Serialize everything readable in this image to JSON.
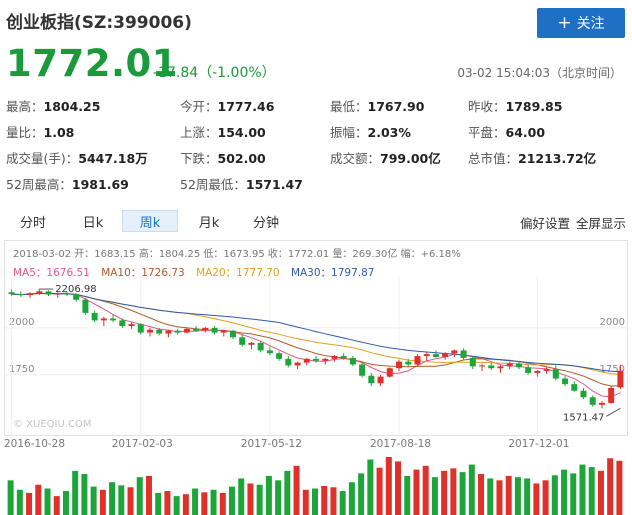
{
  "header": {
    "title": "创业板指(SZ:399006)",
    "follow_label": "关注",
    "price": "1772.01",
    "change": "-17.84（-1.00%）",
    "timestamp": "03-02 15:04:03（北京时间）"
  },
  "stats": [
    {
      "label": "最高：",
      "value": "1804.25"
    },
    {
      "label": "今开：",
      "value": "1777.46"
    },
    {
      "label": "最低：",
      "value": "1767.90"
    },
    {
      "label": "昨收：",
      "value": "1789.85"
    },
    {
      "label": "量比：",
      "value": "1.08"
    },
    {
      "label": "上涨：",
      "value": "154.00"
    },
    {
      "label": "振幅：",
      "value": "2.03%"
    },
    {
      "label": "平盘：",
      "value": "64.00"
    },
    {
      "label": "成交量(手)：",
      "value": "5447.18万"
    },
    {
      "label": "下跌：",
      "value": "502.00"
    },
    {
      "label": "成交额：",
      "value": "799.00亿"
    },
    {
      "label": "总市值：",
      "value": "21213.72亿"
    },
    {
      "label": "52周最高：",
      "value": "1981.69"
    },
    {
      "label": "52周最低：",
      "value": "1571.47"
    }
  ],
  "tabs": [
    {
      "label": "分时"
    },
    {
      "label": "日k"
    },
    {
      "label": "周k"
    },
    {
      "label": "月k"
    },
    {
      "label": "分钟"
    }
  ],
  "tab_active": "周k",
  "tools": {
    "settings": "偏好设置",
    "fullscreen": "全屏显示"
  },
  "chart_info": "2018-03-02 开：1683.15 高：1804.25 低：1673.95 收：1772.01 量：269.30亿 幅：+6.18%",
  "ma_legend": [
    {
      "label": "MA5：1676.51",
      "color": "#e05a8a"
    },
    {
      "label": "MA10：1726.73",
      "color": "#b05a2a"
    },
    {
      "label": "MA20：1777.70",
      "color": "#e0a020"
    },
    {
      "label": "MA30：1797.87",
      "color": "#2f5aa8"
    }
  ],
  "watermark": "© XUEQIU.COM",
  "colors": {
    "up": "#e0302a",
    "down": "#1ea53a",
    "accent": "#1f6fc5"
  },
  "chart_data": {
    "type": "candlestick",
    "y_ticks": [
      {
        "value": 2000,
        "label": "2000"
      },
      {
        "value": 1750,
        "label": "1750"
      }
    ],
    "ylim": [
      1525,
      2250
    ],
    "x_ticks": [
      "2016-10-28",
      "2017-02-03",
      "2017-05-12",
      "2017-08-18",
      "2017-12-01"
    ],
    "x_tick_indices": [
      0,
      14,
      28,
      42,
      57
    ],
    "annotations": [
      {
        "text": "2206.98",
        "index": 3,
        "value": 2206.98
      },
      {
        "text": "1571.47",
        "index": 66,
        "value": 1571.47
      }
    ],
    "candles": [
      [
        2190,
        2205,
        2170,
        2180
      ],
      [
        2180,
        2195,
        2165,
        2175
      ],
      [
        2175,
        2190,
        2160,
        2185
      ],
      [
        2185,
        2207,
        2175,
        2195
      ],
      [
        2195,
        2200,
        2170,
        2178
      ],
      [
        2178,
        2190,
        2160,
        2183
      ],
      [
        2183,
        2195,
        2170,
        2180
      ],
      [
        2180,
        2185,
        2140,
        2150
      ],
      [
        2150,
        2160,
        2070,
        2080
      ],
      [
        2080,
        2090,
        2030,
        2040
      ],
      [
        2040,
        2060,
        2010,
        2050
      ],
      [
        2050,
        2070,
        2030,
        2040
      ],
      [
        2040,
        2050,
        2000,
        2010
      ],
      [
        2010,
        2030,
        1995,
        2020
      ],
      [
        2020,
        2025,
        1965,
        1975
      ],
      [
        1975,
        2000,
        1955,
        1990
      ],
      [
        1990,
        2000,
        1960,
        1970
      ],
      [
        1970,
        1990,
        1950,
        1985
      ],
      [
        1985,
        1995,
        1965,
        1975
      ],
      [
        1975,
        2000,
        1970,
        1995
      ],
      [
        1995,
        2010,
        1980,
        1985
      ],
      [
        1985,
        2005,
        1975,
        2000
      ],
      [
        2000,
        2010,
        1965,
        1975
      ],
      [
        1975,
        1990,
        1955,
        1985
      ],
      [
        1985,
        1990,
        1940,
        1950
      ],
      [
        1950,
        1965,
        1900,
        1910
      ],
      [
        1910,
        1925,
        1885,
        1920
      ],
      [
        1920,
        1930,
        1870,
        1880
      ],
      [
        1880,
        1900,
        1855,
        1865
      ],
      [
        1865,
        1875,
        1825,
        1835
      ],
      [
        1835,
        1850,
        1790,
        1800
      ],
      [
        1800,
        1820,
        1780,
        1815
      ],
      [
        1815,
        1840,
        1800,
        1835
      ],
      [
        1835,
        1850,
        1815,
        1825
      ],
      [
        1825,
        1840,
        1805,
        1835
      ],
      [
        1835,
        1855,
        1820,
        1850
      ],
      [
        1850,
        1865,
        1830,
        1840
      ],
      [
        1840,
        1850,
        1795,
        1805
      ],
      [
        1805,
        1815,
        1735,
        1745
      ],
      [
        1745,
        1760,
        1690,
        1705
      ],
      [
        1705,
        1750,
        1690,
        1740
      ],
      [
        1740,
        1790,
        1735,
        1785
      ],
      [
        1785,
        1830,
        1770,
        1820
      ],
      [
        1820,
        1835,
        1790,
        1805
      ],
      [
        1805,
        1860,
        1800,
        1850
      ],
      [
        1850,
        1870,
        1825,
        1860
      ],
      [
        1860,
        1880,
        1840,
        1845
      ],
      [
        1845,
        1870,
        1830,
        1865
      ],
      [
        1865,
        1885,
        1845,
        1880
      ],
      [
        1880,
        1890,
        1830,
        1840
      ],
      [
        1840,
        1850,
        1780,
        1795
      ],
      [
        1795,
        1810,
        1770,
        1800
      ],
      [
        1800,
        1815,
        1775,
        1785
      ],
      [
        1785,
        1800,
        1760,
        1795
      ],
      [
        1795,
        1820,
        1780,
        1810
      ],
      [
        1810,
        1825,
        1780,
        1790
      ],
      [
        1790,
        1805,
        1750,
        1760
      ],
      [
        1760,
        1775,
        1740,
        1770
      ],
      [
        1770,
        1790,
        1755,
        1780
      ],
      [
        1780,
        1800,
        1720,
        1730
      ],
      [
        1730,
        1745,
        1690,
        1700
      ],
      [
        1700,
        1715,
        1660,
        1665
      ],
      [
        1665,
        1680,
        1620,
        1630
      ],
      [
        1630,
        1640,
        1580,
        1590
      ],
      [
        1590,
        1610,
        1571,
        1600
      ],
      [
        1600,
        1690,
        1595,
        1680
      ],
      [
        1683,
        1804,
        1673,
        1772
      ]
    ],
    "volumes": [
      55,
      40,
      35,
      48,
      42,
      30,
      38,
      70,
      65,
      45,
      40,
      52,
      47,
      44,
      60,
      62,
      35,
      38,
      30,
      33,
      42,
      36,
      40,
      35,
      45,
      58,
      50,
      48,
      62,
      55,
      70,
      78,
      40,
      42,
      46,
      44,
      38,
      52,
      66,
      88,
      75,
      92,
      85,
      62,
      72,
      78,
      60,
      70,
      74,
      68,
      80,
      65,
      58,
      55,
      62,
      60,
      58,
      50,
      55,
      63,
      72,
      66,
      80,
      76,
      70,
      90,
      86
    ]
  }
}
